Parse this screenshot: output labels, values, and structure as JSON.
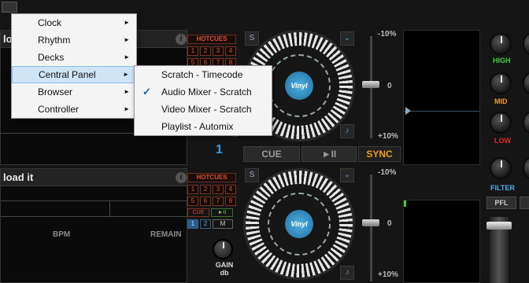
{
  "deck_top": {
    "title": "lo",
    "deck_number": "1"
  },
  "deck_bottom": {
    "title": "load it",
    "bpm_label": "BPM",
    "remain_label": "REMAIN"
  },
  "hotcues": {
    "title": "HOTCUES",
    "row1": [
      "1",
      "2",
      "3",
      "4"
    ],
    "row2": [
      "5",
      "6",
      "7",
      "8"
    ],
    "cue_label": "CUE",
    "play_label": "►II",
    "deck_nums": [
      "1",
      "2"
    ],
    "m_label": "M",
    "gain_label": "GAIN",
    "gain_unit": "db"
  },
  "deck_controls": {
    "cue_label": "CUE",
    "play_label": "►II",
    "sync_label": "SYNC",
    "s_label": "S",
    "chevron_label": "⌄",
    "note_label": "♪",
    "vinyl_label": "Vinyl"
  },
  "pitch": {
    "top": "-10%",
    "mid": "0",
    "bottom": "+10%"
  },
  "eq": {
    "high": "HIGH",
    "mid": "MID",
    "low": "LOW",
    "filter": "FILTER",
    "pfl": "PFL"
  },
  "colors": {
    "high": "#3fcf3f",
    "mid": "#f0a020",
    "low": "#e02a2a",
    "filter": "#4fb0e3",
    "sync": "#f0a020"
  },
  "main_menu": {
    "items": [
      {
        "label": "Clock",
        "has_submenu": true
      },
      {
        "label": "Rhythm",
        "has_submenu": true
      },
      {
        "label": "Decks",
        "has_submenu": true
      },
      {
        "label": "Central Panel",
        "has_submenu": true,
        "highlighted": true
      },
      {
        "label": "Browser",
        "has_submenu": true
      },
      {
        "label": "Controller",
        "has_submenu": true
      }
    ]
  },
  "sub_menu": {
    "items": [
      {
        "label": "Scratch - Timecode",
        "checked": false
      },
      {
        "label": "Audio Mixer - Scratch",
        "checked": true
      },
      {
        "label": "Video Mixer - Scratch",
        "checked": false
      },
      {
        "label": "Playlist - Automix",
        "checked": false
      }
    ]
  }
}
